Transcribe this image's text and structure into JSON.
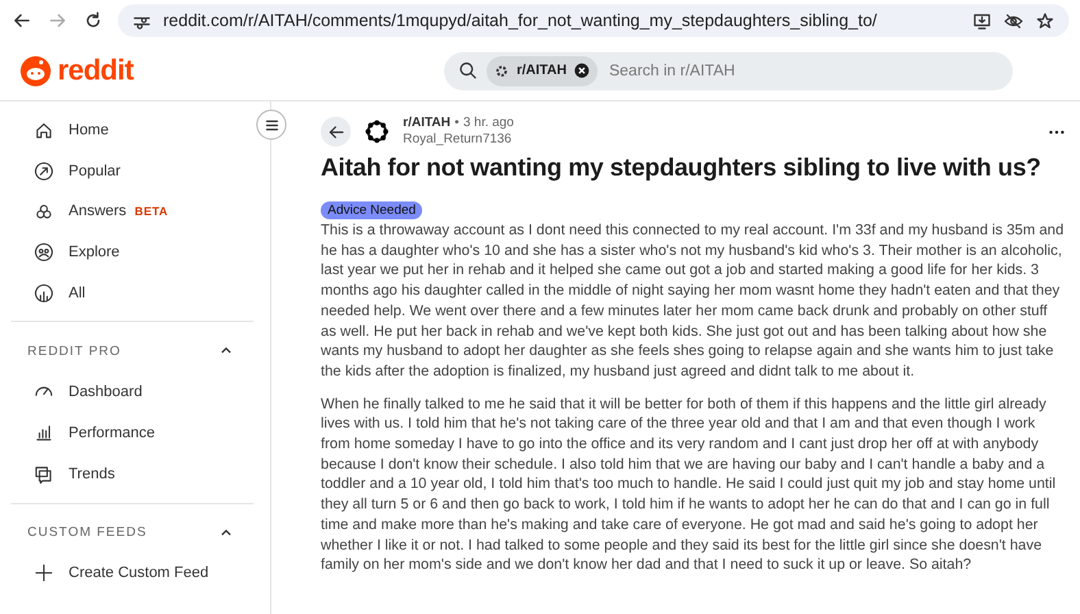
{
  "browser": {
    "url": "reddit.com/r/AITAH/comments/1mqupyd/aitah_for_not_wanting_my_stepdaughters_sibling_to/"
  },
  "header": {
    "logo": "reddit",
    "search": {
      "chip": "r/AITAH",
      "placeholder": "Search in r/AITAH"
    }
  },
  "sidebar": {
    "items": [
      {
        "label": "Home"
      },
      {
        "label": "Popular"
      },
      {
        "label": "Answers",
        "badge": "BETA"
      },
      {
        "label": "Explore"
      },
      {
        "label": "All"
      }
    ],
    "sections": [
      {
        "title": "REDDIT PRO",
        "expanded": true,
        "items": [
          {
            "label": "Dashboard"
          },
          {
            "label": "Performance"
          },
          {
            "label": "Trends"
          }
        ]
      },
      {
        "title": "CUSTOM FEEDS",
        "expanded": true,
        "items": [
          {
            "label": "Create Custom Feed"
          }
        ]
      }
    ]
  },
  "post": {
    "subreddit": "r/AITAH",
    "separator": "•",
    "time": "3 hr. ago",
    "author": "Royal_Return7136",
    "title": "Aitah for not wanting my stepdaughters sibling to live with us?",
    "flair": "Advice Needed",
    "paragraphs": [
      "This is a throwaway account as I dont need this connected to my real account. I'm 33f and my husband is 35m and he has a daughter who's 10 and she has a sister who's not my husband's kid who's 3. Their mother is an alcoholic, last year we put her in rehab and it helped she came out got a job and started making a good life for her kids. 3 months ago his daughter called in the middle of night saying her mom wasnt home they hadn't eaten and that they needed help. We went over there and a few minutes later her mom came back drunk and probably on other stuff as well. He put her back in rehab and we've kept both kids. She just got out and has been talking about how she wants my husband to adopt her daughter as she feels shes going to relapse again and she wants him to just take the kids after the adoption is finalized, my husband just agreed and didnt talk to me about it.",
      "When he finally talked to me he said that it will be better for both of them if this happens and the little girl already lives with us. I told him that he's not taking care of the three year old and that I am and that even though I work from home someday I have to go into the office and its very random and I cant just drop her off at with anybody because I don't know their schedule. I also told him that we are having our baby and I can't handle a baby and a toddler and a 10 year old, I told him that's too much to handle. He said I could just quit my job and stay home until they all turn 5 or 6 and then go back to work, I told him if he wants to adopt her he can do that and I can go in full time and make more than he's making and take care of everyone. He got mad and said he's going to adopt her whether I like it or not. I had talked to some people and they said its best for the little girl since she doesn't have family on her mom's side and we don't know her dad and that I need to suck it up or leave. So aitah?"
    ]
  }
}
